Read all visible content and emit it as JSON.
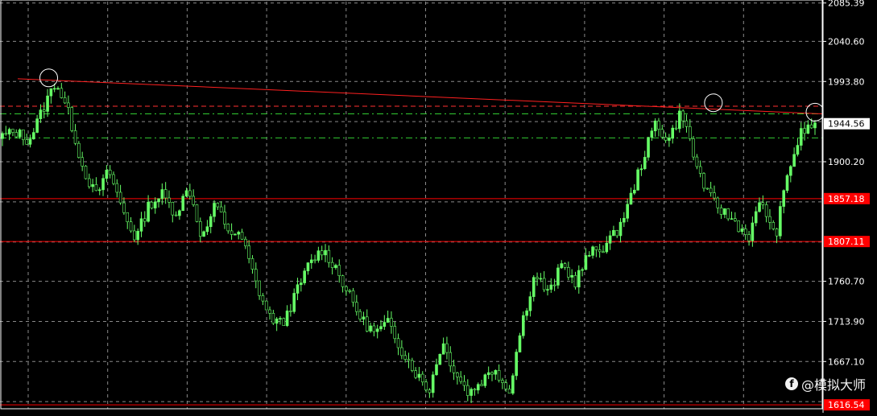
{
  "chart_data": {
    "type": "candlestick",
    "y_axis": {
      "ticks": [
        "2085.39",
        "2040.60",
        "1993.80",
        "1900.20",
        "1760.70",
        "1713.90",
        "1667.10"
      ],
      "ylim": [
        1612,
        2087
      ]
    },
    "current_price": {
      "label": "1944.56",
      "value": 1944.56,
      "color": "#ffffff"
    },
    "horizontal_levels": [
      {
        "label": "1857.18",
        "value": 1857.18,
        "color": "#ff0000",
        "style": "solid"
      },
      {
        "label": "1807.11",
        "value": 1807.11,
        "color": "#ff0000",
        "style": "solid"
      },
      {
        "label": "1616.54",
        "value": 1616.54,
        "color": "#ff0000",
        "style": "solid"
      },
      {
        "label": "",
        "value": 1965,
        "color": "#ff3030",
        "style": "dashed"
      },
      {
        "label": "",
        "value": 1956,
        "color": "#33cc33",
        "style": "dashdot"
      },
      {
        "label": "",
        "value": 1928,
        "color": "#33cc33",
        "style": "dashdot"
      }
    ],
    "trendline": {
      "color": "#ff2020",
      "from": {
        "bar": 0,
        "price": 1997
      },
      "to": {
        "bar": 1,
        "price": 1956
      }
    },
    "markers": [
      {
        "bar_fraction": 0.057,
        "price": 1998,
        "name": "peak-1"
      },
      {
        "bar_fraction": 0.875,
        "price": 1969,
        "name": "peak-2"
      },
      {
        "bar_fraction": 1.0,
        "price": 1958,
        "name": "peak-3"
      }
    ],
    "price_path": [
      1930,
      1935,
      1925,
      1960,
      1995,
      1955,
      1895,
      1860,
      1890,
      1845,
      1810,
      1850,
      1862,
      1840,
      1870,
      1810,
      1850,
      1820,
      1810,
      1760,
      1720,
      1710,
      1745,
      1780,
      1798,
      1778,
      1745,
      1715,
      1700,
      1712,
      1680,
      1655,
      1632,
      1690,
      1655,
      1630,
      1645,
      1660,
      1630,
      1712,
      1770,
      1745,
      1780,
      1760,
      1792,
      1800,
      1815,
      1850,
      1900,
      1945,
      1925,
      1960,
      1900,
      1860,
      1843,
      1830,
      1812,
      1856,
      1810,
      1890,
      1935,
      1944
    ],
    "bullish_color": "#66ff66",
    "grid": true
  },
  "watermark": {
    "text": "@模拟大师",
    "icon": "f"
  }
}
